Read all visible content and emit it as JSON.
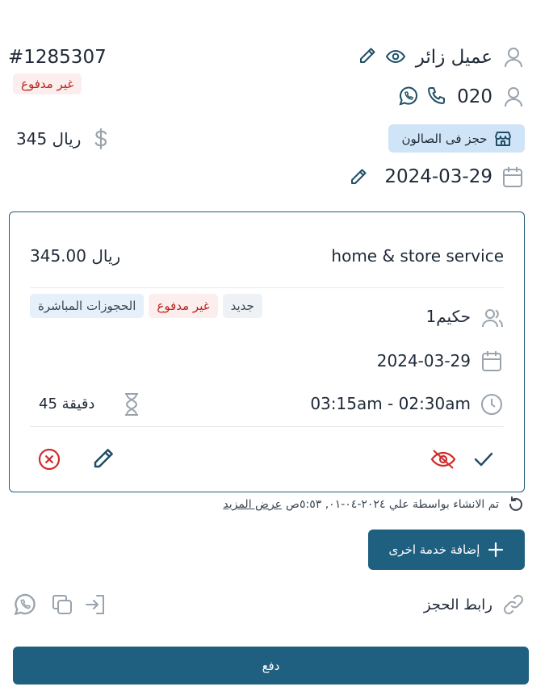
{
  "header": {
    "booking_number": "#1285307",
    "payment_status": "غير مدفوع",
    "customer_name": "عميل زائر",
    "phone": "020",
    "location_badge": "حجز فى الصالون",
    "total": "345 ريال",
    "date": "2024-03-29"
  },
  "service_card": {
    "service_name": "home & store service",
    "price": "345.00 ريال",
    "staff": "حكيم1",
    "tags": [
      "جديد",
      "غير مدفوع",
      "الحجوزات المباشرة"
    ],
    "date": "2024-03-29",
    "time": "03:15am - 02:30am",
    "duration": "45 دقيقة"
  },
  "created_info": {
    "text": "تم الانشاء بواسطة علي ٢٠٢٤-٠٤-٠١, ٥:٥٣ص",
    "more_link": "عرض المزيد"
  },
  "add_service_button": "إضافة خدمة اخرى",
  "booking_link_label": "رابط الحجز",
  "pay_button": "دفع",
  "colors": {
    "primary": "#1f5f7f",
    "danger": "#d12b2b",
    "badge_blue": "#cfe4f6"
  }
}
